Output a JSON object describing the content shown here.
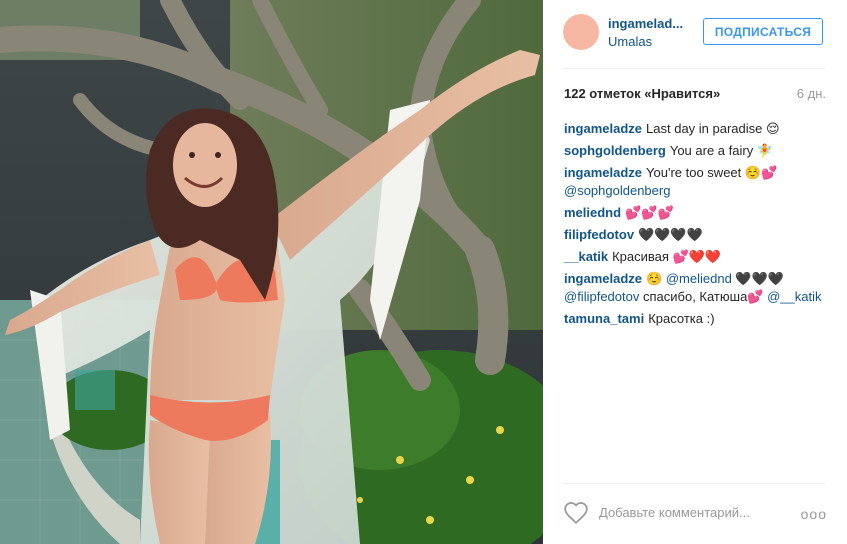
{
  "post": {
    "username": "ingameladze",
    "username_display": "ingamelad...",
    "location": "Umalas",
    "follow_label": "ПОДПИСАТЬСЯ",
    "likes": "122 отметок «Нравится»",
    "time": "6 дн."
  },
  "comments": [
    {
      "user": "ingameladze",
      "text": "Last day in paradise 😌"
    },
    {
      "user": "sophgoldenberg",
      "text": "You are a fairy 🧚"
    },
    {
      "user": "ingameladze",
      "text": "You're too sweet ☺️💕",
      "mention": "@sophgoldenberg"
    },
    {
      "user": "meliednd",
      "text": "💕💕💕"
    },
    {
      "user": "filipfedotov",
      "text": "🖤🖤🖤🖤"
    },
    {
      "user": "__katik",
      "text": "Красивая 💕❤️❤️"
    },
    {
      "user": "ingameladze",
      "text": "☺️",
      "mention": "@meliednd",
      "text2": "🖤🖤🖤",
      "mention2": "@filipfedotov",
      "text3": "спасибо, Катюша💕",
      "mention3": "@__katik"
    },
    {
      "user": "tamuna_tami",
      "text": "Красотка :)"
    }
  ],
  "footer": {
    "placeholder": "Добавьте комментарий...",
    "more": "ooo"
  },
  "icons": {
    "heart": "heart-icon",
    "more": "ellipsis-icon"
  },
  "colors": {
    "link": "#125688",
    "follow": "#3897f0",
    "avatar": "#f6b7a3"
  }
}
